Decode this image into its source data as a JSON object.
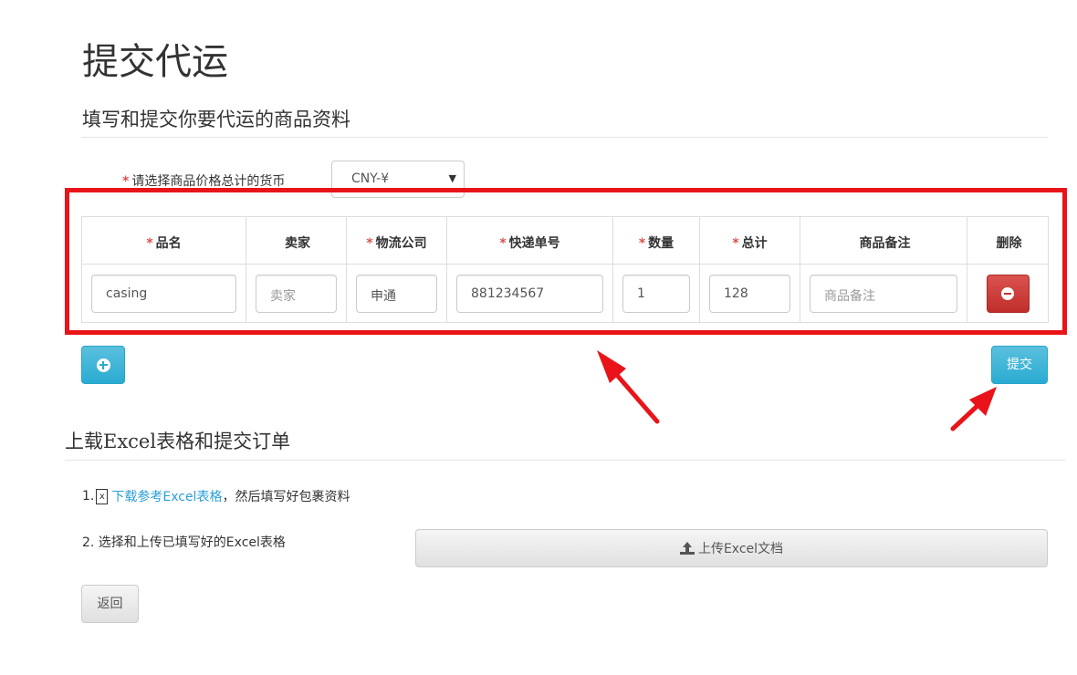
{
  "page": {
    "title": "提交代运",
    "subtitle": "填写和提交你要代运的商品资料"
  },
  "currency": {
    "required_mark": "*",
    "label": "请选择商品价格总计的货币",
    "selected": "CNY-¥"
  },
  "table": {
    "headers": [
      {
        "label": "品名",
        "required": "*"
      },
      {
        "label": "卖家",
        "required": ""
      },
      {
        "label": "物流公司",
        "required": "*"
      },
      {
        "label": "快递单号",
        "required": "*"
      },
      {
        "label": "数量",
        "required": "*"
      },
      {
        "label": "总计",
        "required": "*"
      },
      {
        "label": "商品备注",
        "required": ""
      },
      {
        "label": "删除",
        "required": ""
      }
    ],
    "rows": [
      {
        "name": "casing",
        "seller_placeholder": "卖家",
        "logistics": "申通",
        "tracking": "881234567",
        "quantity": "1",
        "total": "128",
        "note_placeholder": "商品备注"
      }
    ]
  },
  "actions": {
    "submit_label": "提交",
    "add_icon": "plus-circle-icon",
    "delete_icon": "minus-circle-icon"
  },
  "excel": {
    "section_title": "上载Excel表格和提交订单",
    "step1_prefix": "1.",
    "step1_link": "下载参考Excel表格",
    "step1_suffix": "，然后填写好包裹资料",
    "excel_icon_glyph": "x",
    "step2": "2. 选择和上传已填写好的Excel表格",
    "upload_label": "上传Excel文档"
  },
  "footer": {
    "back_label": "返回"
  },
  "colors": {
    "highlight": "#e8141a",
    "info": "#2aabd2",
    "danger": "#c9302c",
    "link": "#2a9fd6"
  }
}
